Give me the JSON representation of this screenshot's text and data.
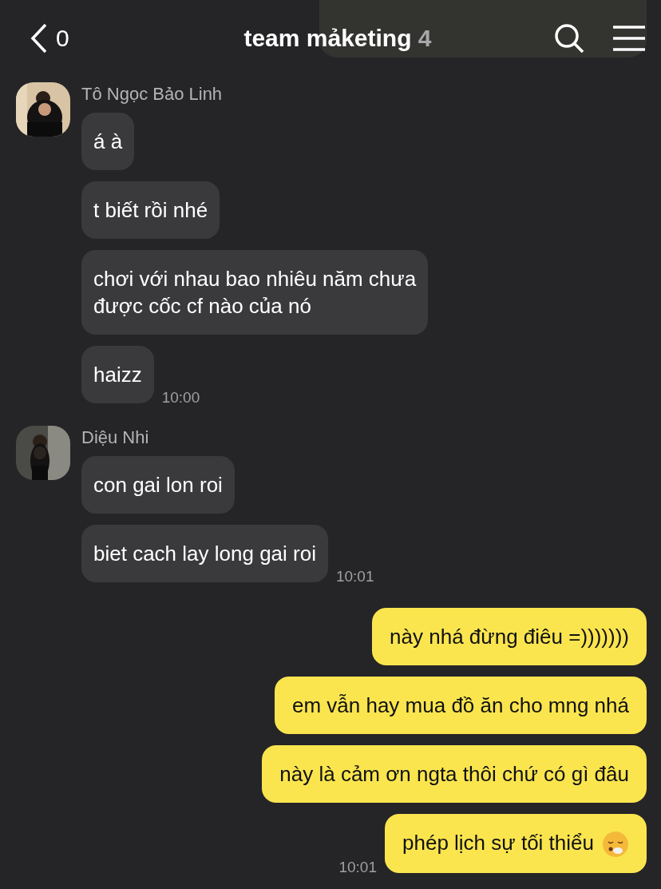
{
  "header": {
    "back_count": "0",
    "title": "team mảketing",
    "member_count": "4"
  },
  "groups": [
    {
      "kind": "incoming",
      "sender": "Tô Ngọc Bảo Linh",
      "avatar": {
        "kind": "picture"
      },
      "messages": [
        "á à",
        "t biết rồi nhé",
        "chơi với nhau bao nhiêu năm chưa\nđược cốc cf nào của nó",
        "haizz"
      ],
      "time": "10:00"
    },
    {
      "kind": "incoming",
      "sender": "Diệu Nhi",
      "avatar": {
        "kind": "picture"
      },
      "messages": [
        "con gai lon roi",
        "biet cach lay long gai roi"
      ],
      "time": "10:01"
    },
    {
      "kind": "outgoing",
      "messages": [
        "này nhá đừng điêu =)))))))",
        "em vẫn hay mua đồ ăn cho mng nhá",
        "này là cảm ơn ngta thôi chứ có gì đâu",
        "phép lịch sự tối thiểu"
      ],
      "emoji_last": true,
      "time": "10:01"
    }
  ]
}
